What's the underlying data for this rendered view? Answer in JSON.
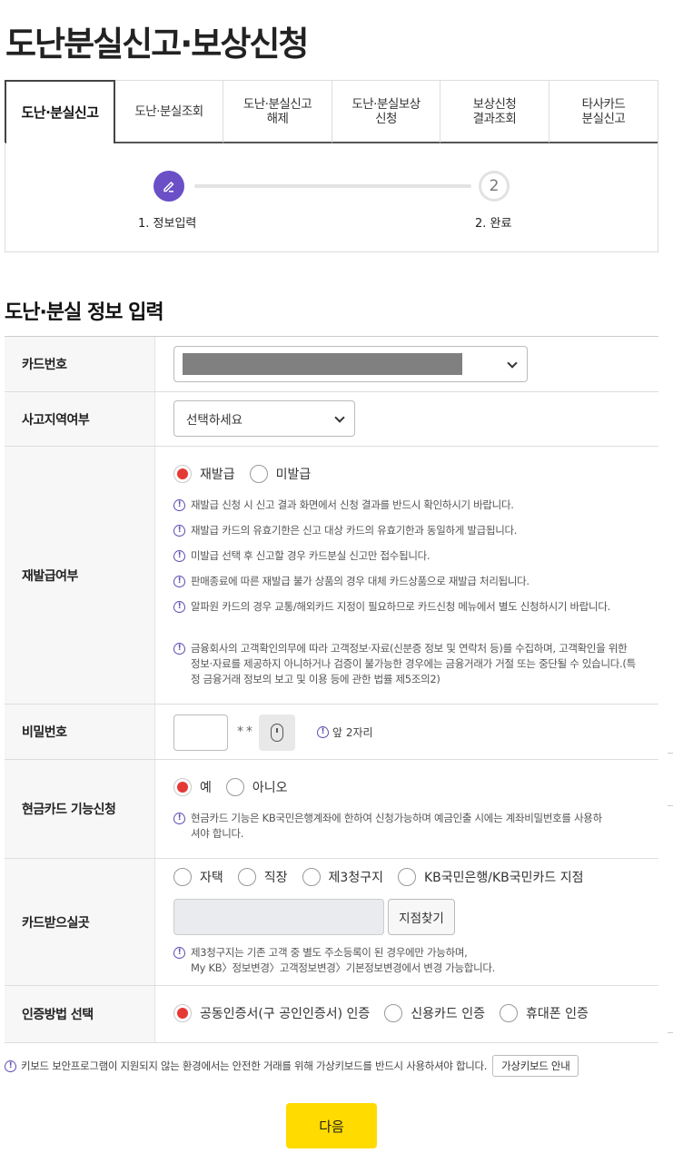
{
  "page": {
    "title": "도난분실신고·보상신청"
  },
  "tabs": [
    {
      "label": "도난·분실신고",
      "active": true
    },
    {
      "label": "도난·분실조회"
    },
    {
      "label": "도난·분실신고\n해제"
    },
    {
      "label": "도난·분실보상\n신청"
    },
    {
      "label": "보상신청\n결과조회"
    },
    {
      "label": "타사카드\n분실신고"
    }
  ],
  "steps": {
    "step1_label": "1. 정보입력",
    "step2_number": "2",
    "step2_label": "2. 완료"
  },
  "section": {
    "title": "도난·분실 정보 입력"
  },
  "form": {
    "card_number": {
      "label": "카드번호",
      "value": ""
    },
    "region": {
      "label": "사고지역여부",
      "value": "선택하세요"
    },
    "reissue": {
      "label": "재발급여부",
      "options": [
        "재발급",
        "미발급"
      ],
      "selected": "재발급",
      "notes": [
        "재발급 신청 시 신고 결과 화면에서 신청 결과를 반드시 확인하시기 바랍니다.",
        "재발급 카드의 유효기한은 신고 대상 카드의 유효기한과 동일하게 발급됩니다.",
        "미발급 선택 후 신고할 경우 카드분실 신고만 접수됩니다.",
        "판매종료에 따른 재발급 불가 상품의 경우 대체 카드상품으로 재발급 처리됩니다.",
        "알파원 카드의 경우 교통/해외카드 지정이 필요하므로 카드신청 메뉴에서 별도 신청하시기 바랍니다.",
        "금융회사의 고객확인의무에 따라 고객정보·자료(신분증 정보 및 연락처 등)를 수집하며, 고객확인을 위한 정보·자료를 제공하지 아니하거나 검증이 불가능한 경우에는 금융거래가 거절 또는 중단될 수 있습니다.(특정 금융거래 정보의 보고 및 이용 등에 관한 법률 제5조의2)"
      ]
    },
    "password": {
      "label": "비밀번호",
      "stars": "**",
      "hint": "앞 2자리"
    },
    "cash_card": {
      "label": "현금카드 기능신청",
      "options": [
        "예",
        "아니오"
      ],
      "selected": "예",
      "note": "현금카드 기능은 KB국민은행계좌에 한하여 신청가능하며 예금인출 시에는 계좌비밀번호를 사용하셔야 합니다."
    },
    "delivery": {
      "label": "카드받으실곳",
      "options": [
        "자택",
        "직장",
        "제3청구지",
        "KB국민은행/KB국민카드 지점"
      ],
      "branch_button": "지점찾기",
      "note_line1": "제3청구지는 기존 고객 중 별도 주소등록이 된 경우에만 가능하며,",
      "note_line2": "My KB〉정보변경〉고객정보변경〉기본정보변경에서 변경 가능합니다."
    },
    "auth": {
      "label": "인증방법 선택",
      "options": [
        "공동인증서(구 공인인증서) 인증",
        "신용카드 인증",
        "휴대폰 인증"
      ],
      "selected": "공동인증서(구 공인인증서) 인증"
    }
  },
  "footer": {
    "note": "키보드 보안프로그램이 지원되지 않는 환경에서는 안전한 거래를 위해 가상키보드를 반드시 사용하셔야 합니다.",
    "keyboard_button": "가상키보드 안내",
    "next_button": "다음"
  },
  "colors": {
    "accent_purple": "#6a4fc7",
    "radio_red": "#e53935",
    "next_yellow": "#ffdb00"
  }
}
